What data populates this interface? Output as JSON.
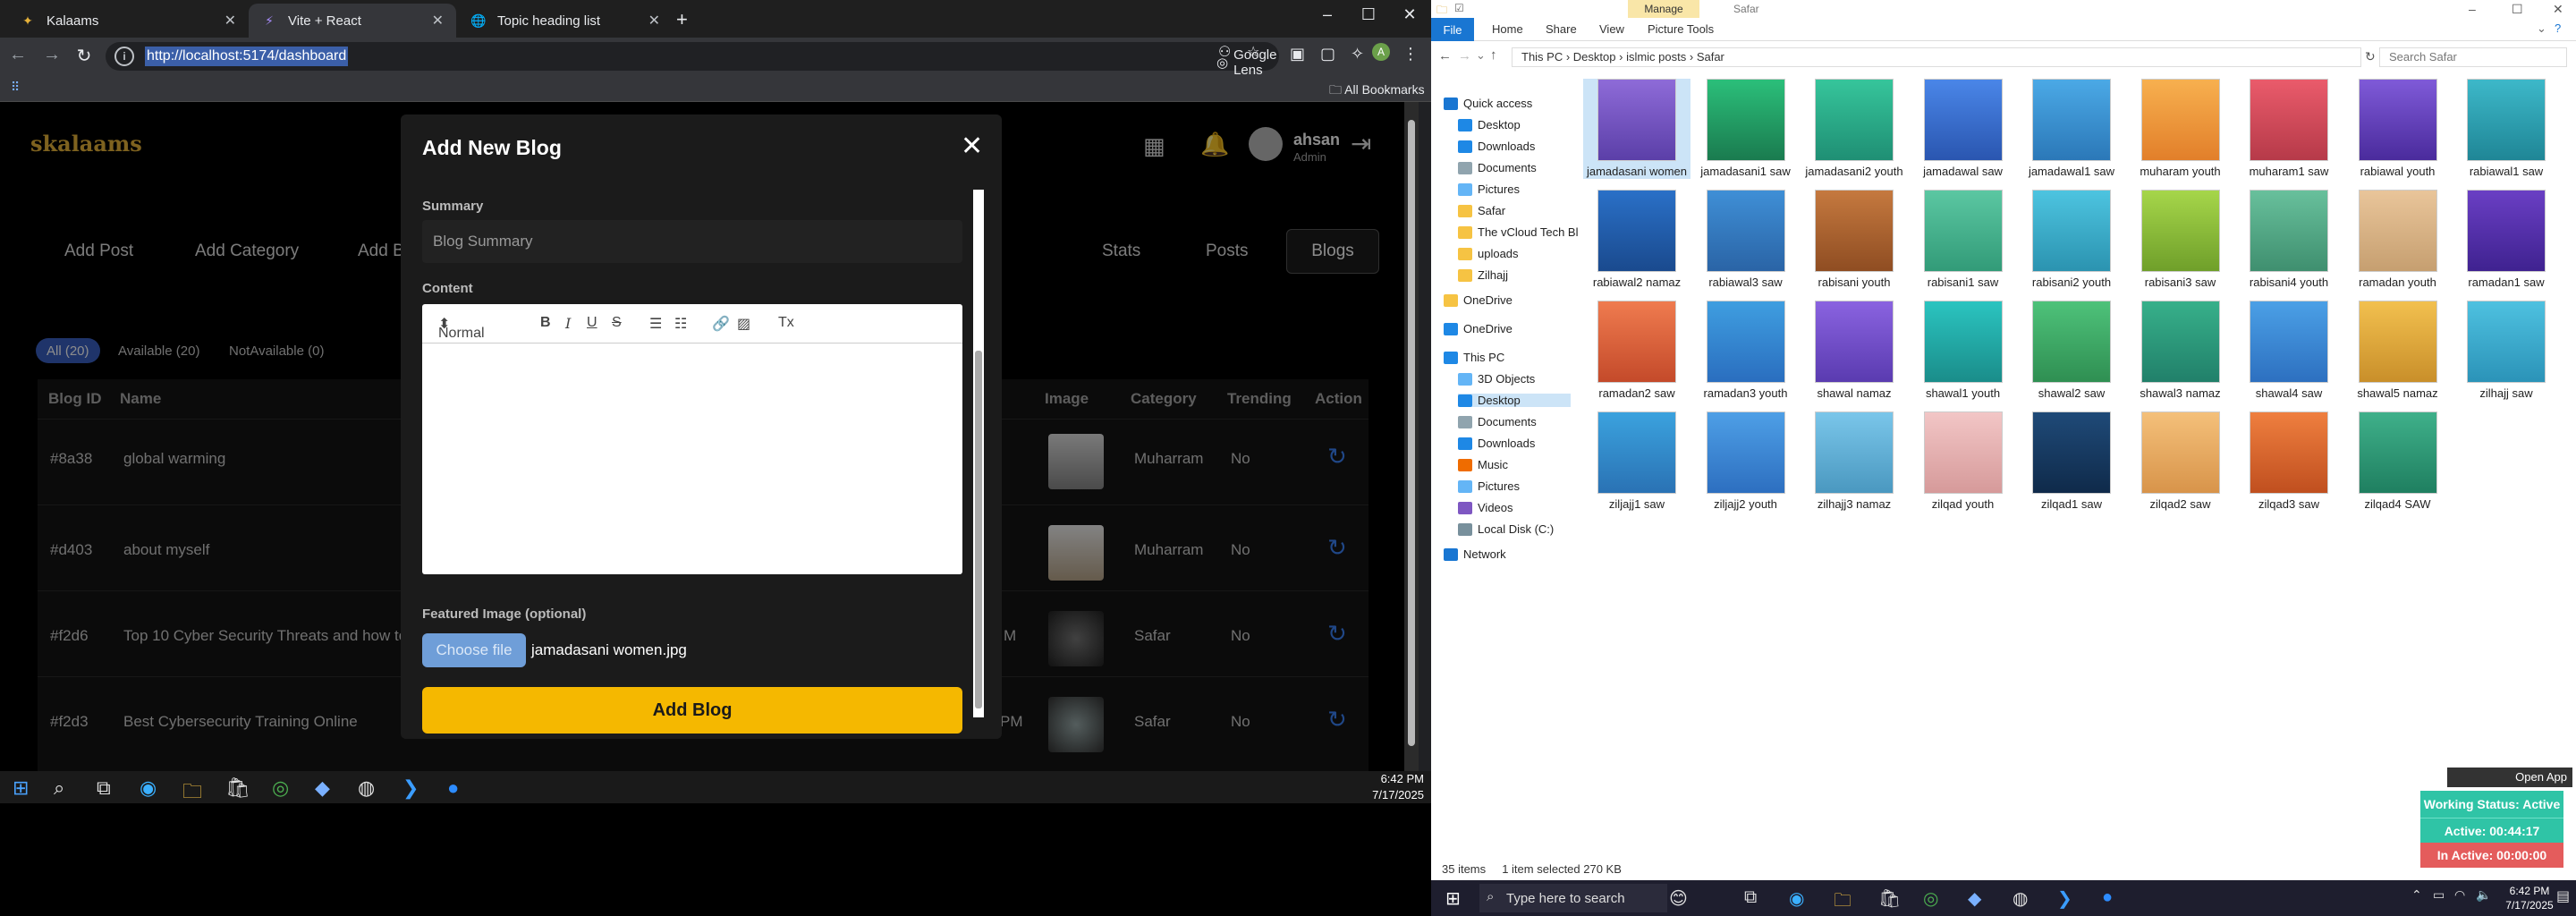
{
  "browser": {
    "tabs": [
      {
        "label": "Kalaams",
        "icon": "kalaams-favicon"
      },
      {
        "label": "Vite + React",
        "icon": "vite-favicon"
      },
      {
        "label": "Topic heading list",
        "icon": "globe-favicon"
      }
    ],
    "url": "http://localhost:5174/dashboard",
    "google_lens": "Google Lens",
    "all_bookmarks": "All Bookmarks"
  },
  "app": {
    "logo": "skalaams",
    "user": {
      "name": "ahsan",
      "role": "Admin"
    },
    "nav_left": [
      "Add Post",
      "Add Category",
      "Add Bl"
    ],
    "nav_right": [
      "Stats",
      "Posts",
      "Blogs"
    ],
    "filters": [
      "All (20)",
      "Available (20)",
      "NotAvailable (0)"
    ],
    "table": {
      "headers": {
        "id": "Blog ID",
        "name": "Name",
        "image": "Image",
        "category": "Category",
        "trending": "Trending",
        "action": "Action"
      },
      "rows": [
        {
          "id": "#8a38",
          "name": "global warming",
          "date": "",
          "category": "Muharram",
          "trending": "No"
        },
        {
          "id": "#d403",
          "name": "about myself",
          "date": "",
          "category": "Muharram",
          "trending": "No"
        },
        {
          "id": "#f2d6",
          "name": "Top 10 Cyber Security Threats and how to",
          "date": "M",
          "category": "Safar",
          "trending": "No"
        },
        {
          "id": "#f2d3",
          "name": "Best Cybersecurity Training Online",
          "date": "PM",
          "category": "Safar",
          "trending": "No"
        }
      ]
    }
  },
  "modal": {
    "title": "Add New Blog",
    "summary_label": "Summary",
    "summary_placeholder": "Blog Summary",
    "content_label": "Content",
    "editor_format": "Normal",
    "featured_label": "Featured Image (optional)",
    "choose_file": "Choose file",
    "file_name": "jamadasani women.jpg",
    "submit": "Add Blog"
  },
  "left_taskbar": {
    "time": "6:42 PM",
    "date": "7/17/2025"
  },
  "explorer": {
    "manage": "Manage",
    "window_title": "Safar",
    "ribbon_tabs": [
      "File",
      "Home",
      "Share",
      "View",
      "Picture Tools"
    ],
    "path": [
      "This PC",
      "Desktop",
      "islmic posts",
      "Safar"
    ],
    "search_placeholder": "Search Safar",
    "nav": [
      "Quick access",
      "Desktop",
      "Downloads",
      "Documents",
      "Pictures",
      "Safar",
      "The vCloud Tech Bl",
      "uploads",
      "Zilhajj",
      "OneDrive",
      "OneDrive",
      "This PC",
      "3D Objects",
      "Desktop",
      "Documents",
      "Downloads",
      "Music",
      "Pictures",
      "Videos",
      "Local Disk (C:)",
      "Network"
    ],
    "files": [
      "jamadasani women",
      "jamadasani1 saw",
      "jamadasani2 youth",
      "jamadawal saw",
      "jamadawal1 saw",
      "muharam youth",
      "muharam1 saw",
      "rabiawal youth",
      "rabiawal1 saw",
      "rabiawal2 namaz",
      "rabiawal3 saw",
      "rabisani youth",
      "rabisani1 saw",
      "rabisani2 youth",
      "rabisani3 saw",
      "rabisani4 youth",
      "ramadan youth",
      "ramadan1 saw",
      "ramadan2 saw",
      "ramadan3 youth",
      "shawal namaz",
      "shawal1 youth",
      "shawal2 saw",
      "shawal3 namaz",
      "shawal4 saw",
      "shawal5 namaz",
      "zilhajj saw",
      "ziljajj1 saw",
      "ziljajj2 youth",
      "zilhajj3 namaz",
      "zilqad youth",
      "zilqad1 saw",
      "zilqad2 saw",
      "zilqad3 saw",
      "zilqad4 SAW"
    ],
    "status_items": "35 items",
    "status_selected": "1 item selected  270 KB",
    "open_app": "Open App",
    "working_status": "Working Status: Active",
    "active_time": "Active: 00:44:17",
    "inactive_time": "In Active: 00:00:00",
    "taskbar_search": "Type here to search",
    "time": "6:42 PM",
    "date": "7/17/2025"
  }
}
